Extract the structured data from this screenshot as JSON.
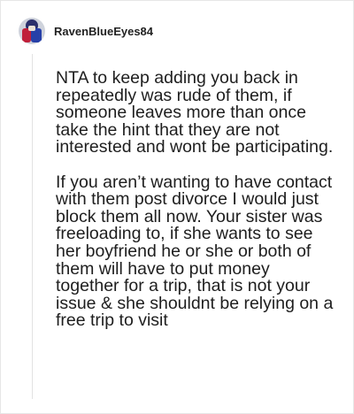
{
  "comment": {
    "username": "RavenBlueEyes84",
    "avatar_icon": "user-avatar-icon",
    "paragraphs": [
      "NTA to keep adding you back in repeatedly was rude of them, if someone leaves more than once take the hint that they are not interested and wont be participating.",
      "If you aren’t wanting to have contact with them post divorce I would just block them all now. Your sister was freeloading to, if she wants to see her boyfriend he or she or both of them will have to put money together for a trip, that is not your issue & she shouldnt be relying on a free trip to visit"
    ]
  },
  "colors": {
    "text": "#1e1e1e",
    "border": "#e6e6e6",
    "thread_line": "#e2e2e2"
  }
}
